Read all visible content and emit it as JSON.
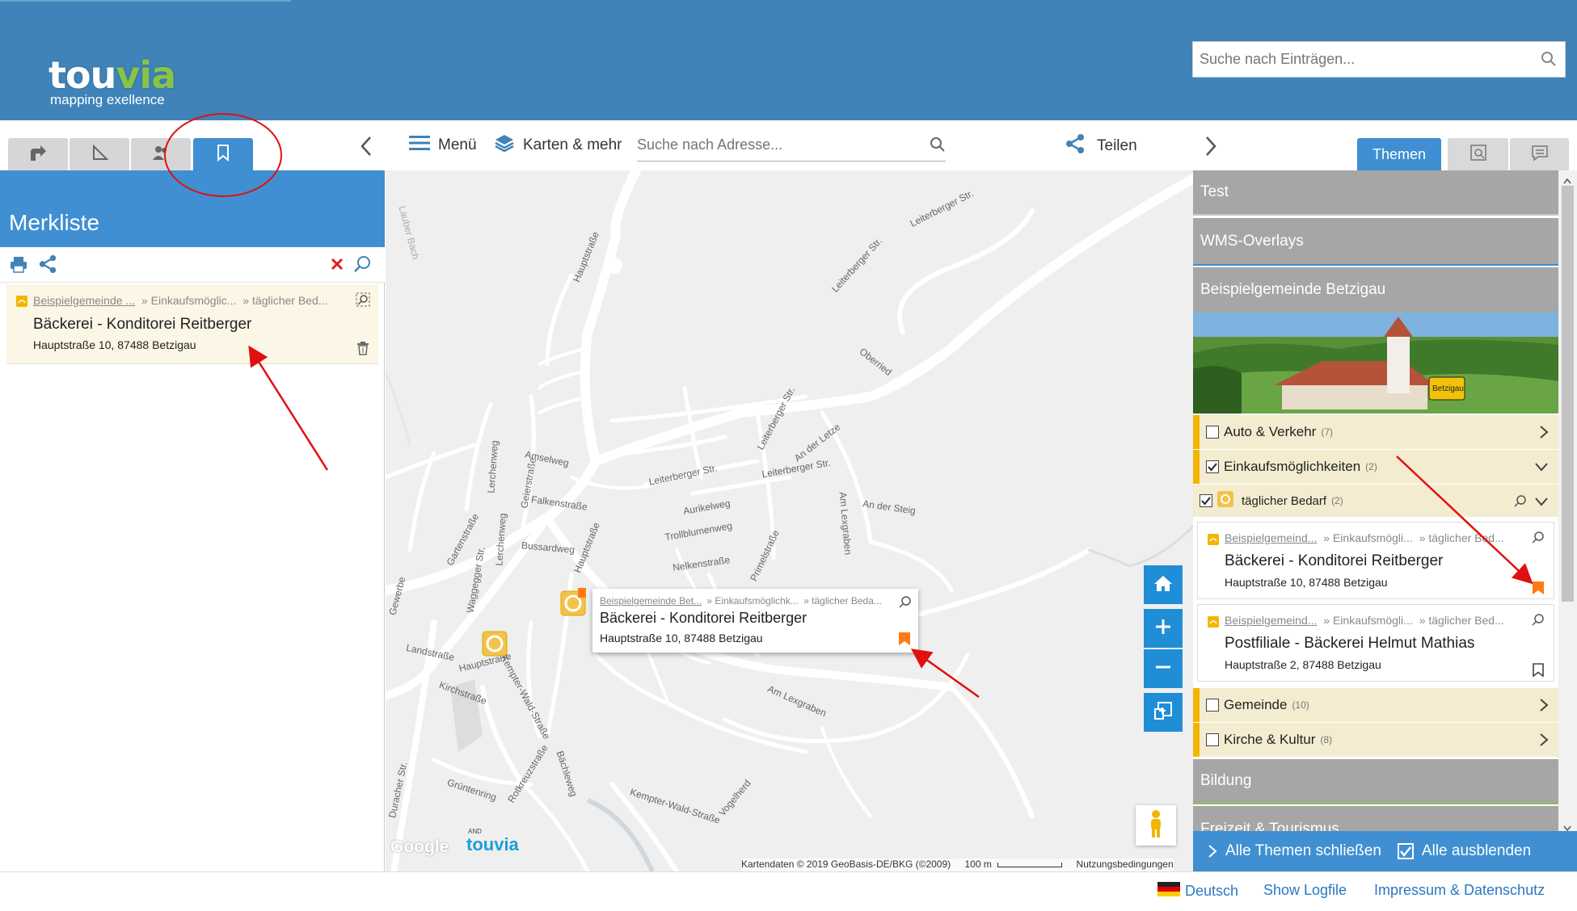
{
  "header": {
    "logo_text_1": "tou",
    "logo_text_2": "via",
    "logo_tagline": "mapping exellence",
    "search_placeholder": "Suche nach Einträgen..."
  },
  "toolbar": {
    "menu_label": "Menü",
    "maps_label": "Karten & mehr",
    "address_placeholder": "Suche nach Adresse...",
    "share_label": "Teilen",
    "themes_tab_label": "Themen"
  },
  "bookmarks": {
    "title": "Merkliste",
    "item": {
      "crumb_1": "Beispielgemeinde ...",
      "crumb_2": "» Einkaufsmöglic...",
      "crumb_3": "» täglicher Bed...",
      "title": "Bäckerei - Konditorei Reitberger",
      "address": "Hauptstraße 10, 87488 Betzigau"
    }
  },
  "map": {
    "labels": [
      "Leiterberger Str.",
      "Leiterberger Str.",
      "Leiterberger Str.",
      "Leiterberger Str.",
      "Leiterberger Str.",
      "Hauptstraße",
      "Hauptstraße",
      "Hauptstraße",
      "Amselweg",
      "Falkenstraße",
      "Aurikelweg",
      "Trollblumenweg",
      "Nelkenstraße",
      "Primelstraße",
      "Bussardweg",
      "Oberried",
      "An der Letze",
      "Am Lexgraben",
      "Am Lexgraben",
      "An der Steig",
      "Gartenstraße",
      "Geierstraße",
      "Lerchenweg",
      "Lerchenweg",
      "Waggegger Str.",
      "Landstraße",
      "Kirchstraße",
      "Kempter-Wald-Straße",
      "Kempter-Wald-Straße",
      "Rotkreuzstraße",
      "Grüntenring",
      "Bächleweg",
      "Vogelherd",
      "Duracher Str.",
      "Lauber Bach",
      "Gewerbe"
    ],
    "popup": {
      "crumb_1": "Beispielgemeinde Bet...",
      "crumb_2": "» Einkaufsmöglichk...",
      "crumb_3": "» täglicher Beda...",
      "title": "Bäckerei - Konditorei Reitberger",
      "address": "Hauptstraße 10, 87488 Betzigau"
    },
    "google_label": "Google",
    "watermark_and": "AND",
    "watermark_brand": "touvia",
    "attribution": "Kartendaten © 2019 GeoBasis-DE/BKG (©2009)",
    "scale": "100 m",
    "terms": "Nutzungsbedingungen"
  },
  "themes": {
    "cat_test": "Test",
    "cat_wms": "WMS-Overlays",
    "cat_betzigau": "Beispielgemeinde Betzigau",
    "sign_text": "Betzigau",
    "sub_auto": {
      "label": "Auto & Verkehr",
      "count": "(7)",
      "checked": false
    },
    "sub_einkauf": {
      "label": "Einkaufsmöglichkeiten",
      "count": "(2)",
      "checked": true
    },
    "sub_taeglich": {
      "label": "täglicher Bedarf",
      "count": "(2)",
      "checked": true
    },
    "entries": [
      {
        "crumb_1": "Beispielgemeind...",
        "crumb_2": "» Einkaufsmögli...",
        "crumb_3": "» täglicher Bed...",
        "title": "Bäckerei - Konditorei Reitberger",
        "address": "Hauptstraße 10, 87488 Betzigau",
        "bookmarked": true
      },
      {
        "crumb_1": "Beispielgemeind...",
        "crumb_2": "» Einkaufsmögli...",
        "crumb_3": "» täglicher Bed...",
        "title": "Postfiliale - Bäckerei Helmut Mathias",
        "address": "Hauptstraße 2, 87488 Betzigau",
        "bookmarked": false
      }
    ],
    "sub_gemeinde": {
      "label": "Gemeinde",
      "count": "(10)",
      "checked": false
    },
    "sub_kirche": {
      "label": "Kirche & Kultur",
      "count": "(8)",
      "checked": false
    },
    "cat_bildung": "Bildung",
    "cat_freizeit": "Freizeit & Tourismus",
    "close_all": "Alle Themen schließen",
    "hide_all": "Alle ausblenden"
  },
  "footer": {
    "language": "Deutsch",
    "logfile": "Show Logfile",
    "imprint": "Impressum & Datenschutz"
  },
  "colors": {
    "header_blue": "#3f83b8",
    "active_tab": "#3f8fd2",
    "bookmark_orange": "#ff7a14",
    "category_gray": "#a6a6a6",
    "annotation_red": "#e01010"
  }
}
